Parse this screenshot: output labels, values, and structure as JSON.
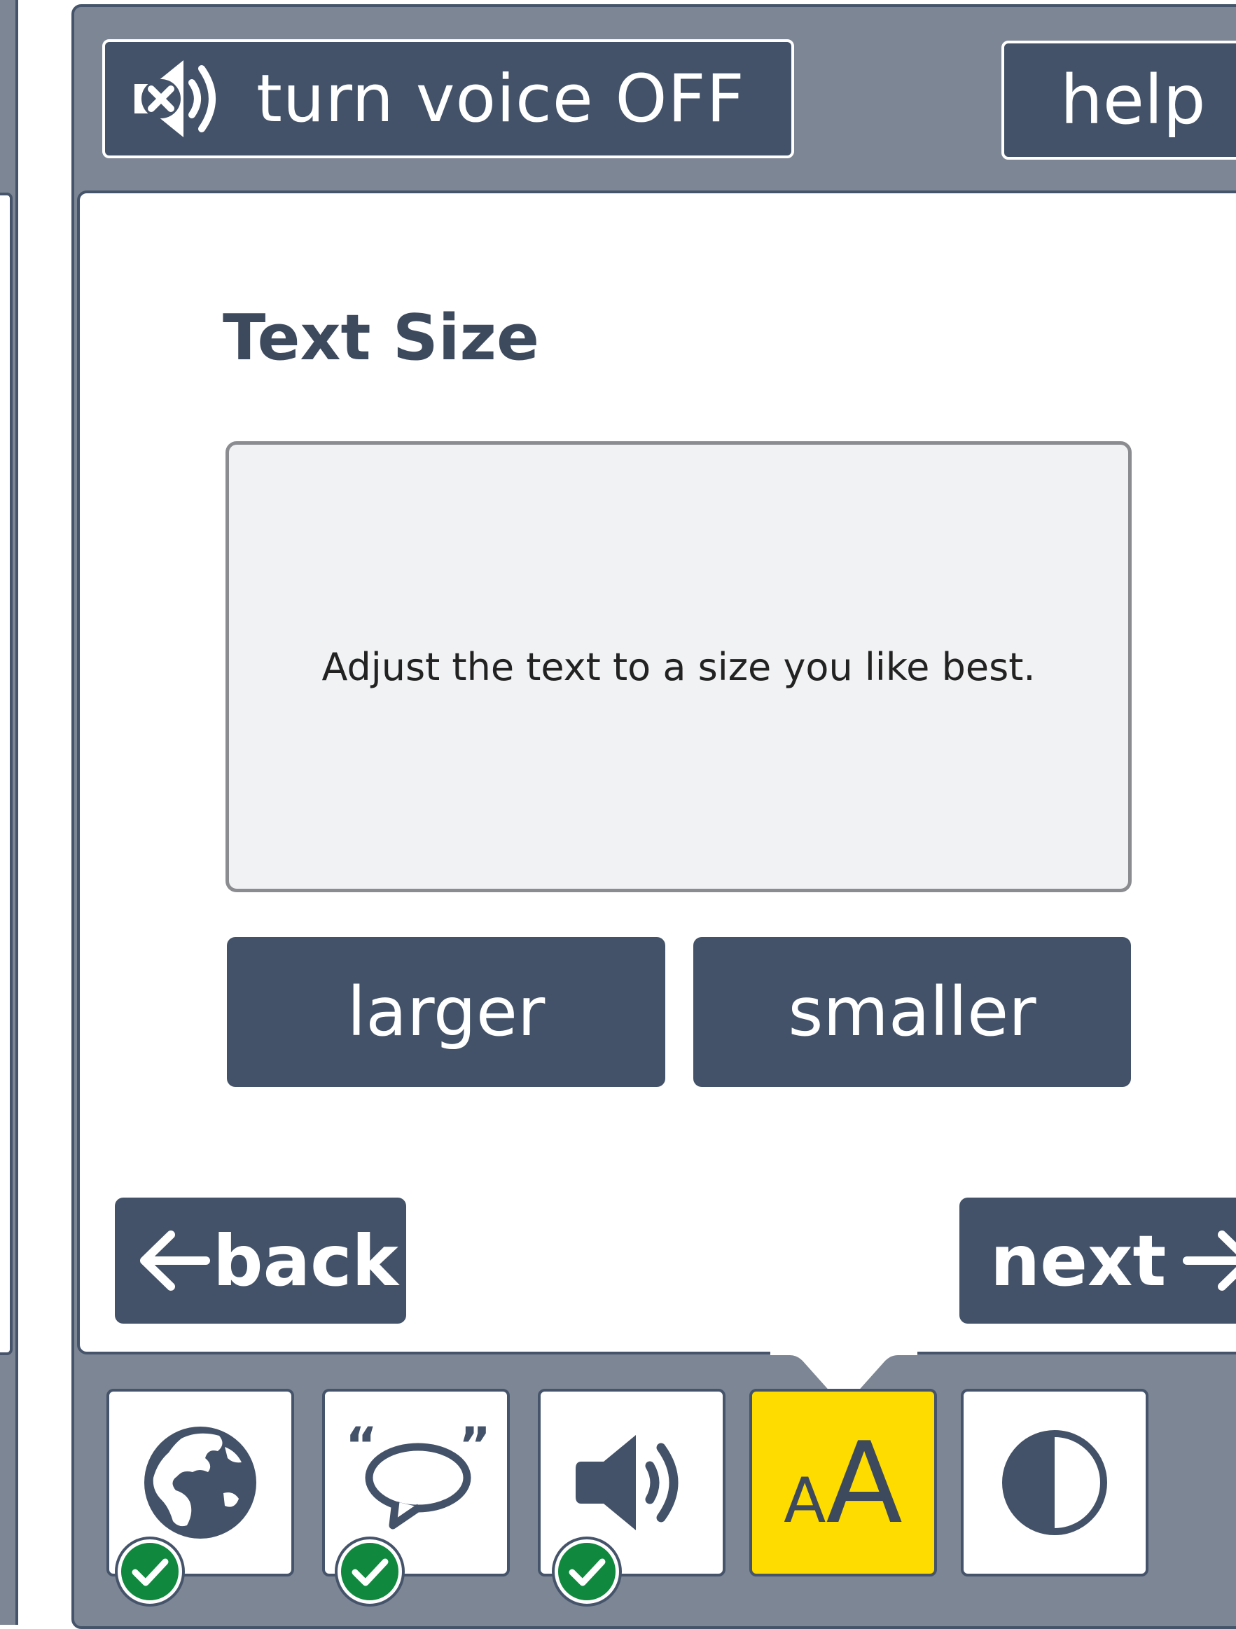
{
  "header": {
    "voice_button_label": "turn voice OFF",
    "help_button_label": "help"
  },
  "main": {
    "title": "Text Size",
    "sample_text": "Adjust the text to a size you like best.",
    "larger_label": "larger",
    "smaller_label": "smaller"
  },
  "nav": {
    "back_label": "back",
    "next_label": "next"
  },
  "toolbar": {
    "tools": [
      {
        "name": "language",
        "icon": "globe-icon",
        "completed": true
      },
      {
        "name": "speech",
        "icon": "speech-bubble-icon",
        "completed": true
      },
      {
        "name": "audio",
        "icon": "speaker-icon",
        "completed": true
      },
      {
        "name": "text-size",
        "icon": "text-size-icon",
        "active": true
      },
      {
        "name": "contrast",
        "icon": "contrast-icon",
        "completed": false
      }
    ],
    "text_size_icon": {
      "small": "A",
      "big": "A"
    }
  },
  "colors": {
    "frame": "#7d8694",
    "dark": "#435268",
    "active_tool": "#fedc00",
    "check": "#10893e"
  }
}
